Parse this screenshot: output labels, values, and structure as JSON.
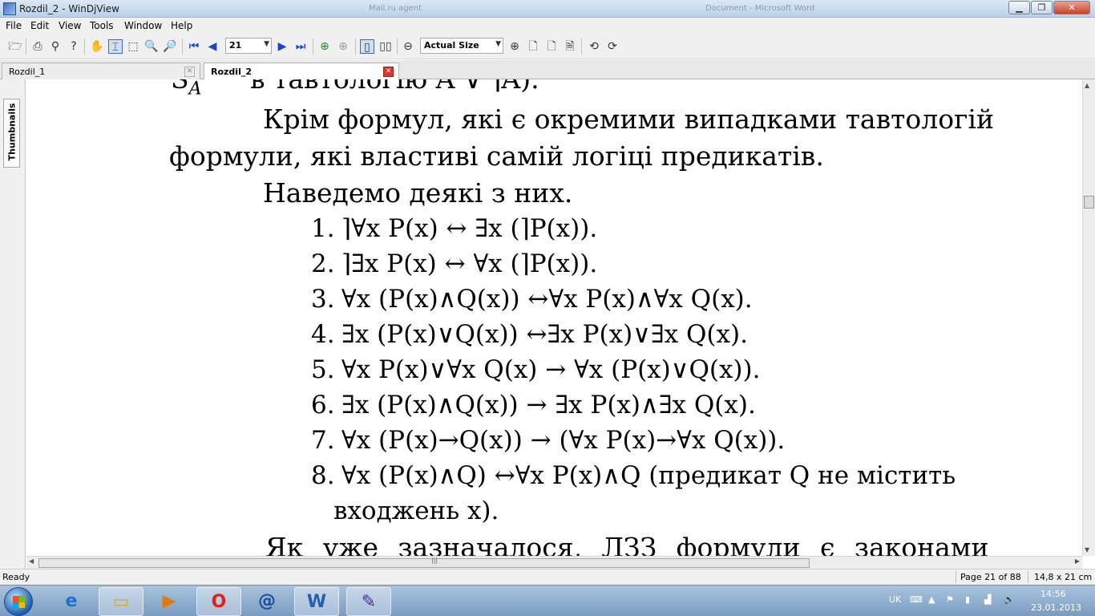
{
  "window": {
    "title": "Rozdil_2 - WinDjView",
    "background_windows": [
      "Mail.ru agent",
      "Document - Microsoft Word"
    ]
  },
  "menu": [
    "File",
    "Edit",
    "View",
    "Tools",
    "Window",
    "Help"
  ],
  "toolbar": {
    "page_number": "21",
    "zoom": "Actual Size"
  },
  "tabs": [
    {
      "label": "Rozdil_1",
      "active": false
    },
    {
      "label": "Rozdil_2",
      "active": true
    }
  ],
  "sidepanel": {
    "thumbnails_label": "Thumbnails"
  },
  "document": {
    "partial_top_line": "в тавтологію  A ∨ ⌉A).",
    "partial_top_prefix": "S",
    "partial_top_sub": "A",
    "para1_line1": "Крім формул, які є окремими випадками тавтологій",
    "para1_line2": "формули, які властиві самій логіці предикатів.",
    "para2": "Наведемо деякі з них.",
    "formulas": [
      {
        "num": "1.",
        "text": "⌉∀x P(x) ↔ ∃x (⌉P(x))."
      },
      {
        "num": "2.",
        "text": "⌉∃x P(x) ↔ ∀x (⌉P(x))."
      },
      {
        "num": "3.",
        "text": "∀x (P(x)∧Q(x)) ↔∀x P(x)∧∀x Q(x)."
      },
      {
        "num": "4.",
        "text": "∃x (P(x)∨Q(x)) ↔∃x P(x)∨∃x Q(x)."
      },
      {
        "num": "5.",
        "text": "∀x P(x)∨∀x Q(x) → ∀x (P(x)∨Q(x))."
      },
      {
        "num": "6.",
        "text": "∃x (P(x)∧Q(x)) → ∃x P(x)∧∃x Q(x)."
      },
      {
        "num": "7.",
        "text": "∀x (P(x)→Q(x)) → (∀x P(x)→∀x Q(x))."
      },
      {
        "num": "8.",
        "text": "∀x (P(x)∧Q) ↔∀x P(x)∧Q (предикат Q не містить"
      }
    ],
    "formula8_continuation": "входжень x).",
    "partial_bottom_line": "Як уже зазначалося, ЛЗЗ формули є законами"
  },
  "status": {
    "left": "Ready",
    "page": "Page 21 of 88",
    "size": "14,8 x 21 cm"
  },
  "taskbar": {
    "language": "UK",
    "time": "14:56",
    "date": "23.01.2013"
  }
}
